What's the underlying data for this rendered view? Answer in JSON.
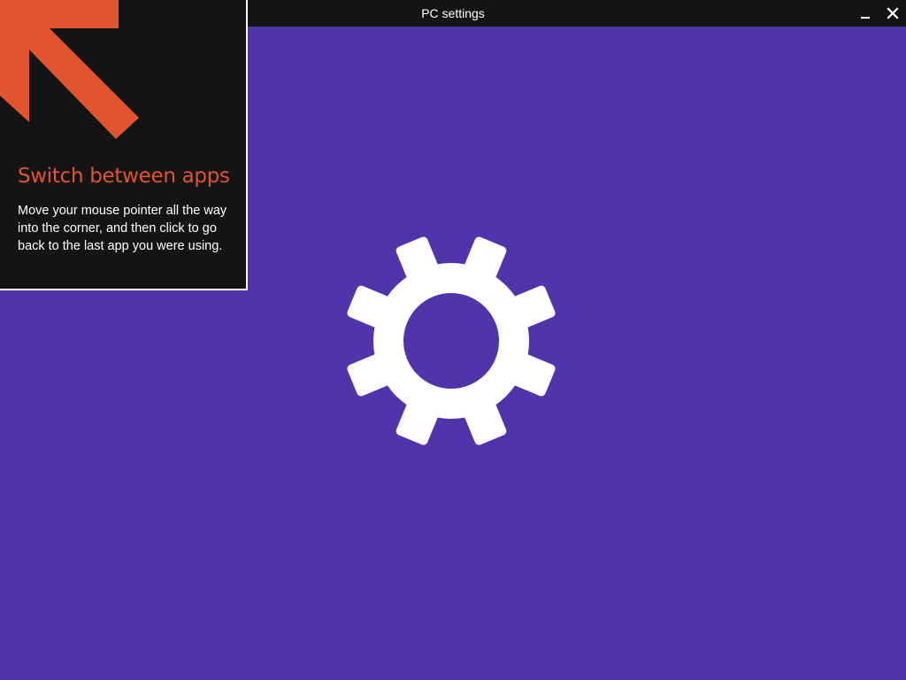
{
  "window": {
    "title": "PC settings",
    "minimize_icon": "minimize-icon",
    "close_icon": "close-icon"
  },
  "splash": {
    "icon": "gear-icon"
  },
  "tip": {
    "icon": "arrow-up-left-icon",
    "title": "Switch between apps",
    "body": "Move your mouse pointer all the way into the corner, and then click to go back to the last app you were using."
  },
  "colors": {
    "background": "#5034ab",
    "titlebar": "#141414",
    "tip_panel": "#141414",
    "accent": "#e0552d",
    "foreground": "#ffffff"
  }
}
